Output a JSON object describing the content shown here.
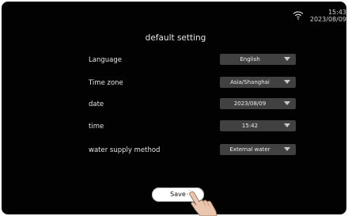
{
  "status_bar": {
    "wifi_icon": "wifi-icon",
    "time": "15:43",
    "date": "2023/08/09"
  },
  "page": {
    "title": "default setting"
  },
  "settings": [
    {
      "label": "Language",
      "value": "English"
    },
    {
      "label": "Time zone",
      "value": "Asia/Shanghai"
    },
    {
      "label": "date",
      "value": "2023/08/09"
    },
    {
      "label": "time",
      "value": "15:42"
    },
    {
      "label": "water supply method",
      "value": "External water"
    }
  ],
  "actions": {
    "save_label": "Save"
  },
  "colors": {
    "background": "#020202",
    "dropdown": "#414141",
    "button": "#ffffff"
  }
}
